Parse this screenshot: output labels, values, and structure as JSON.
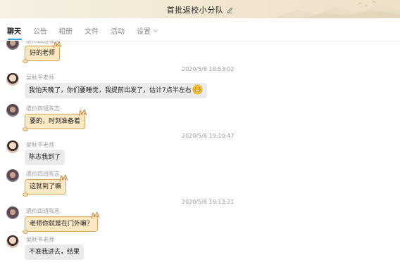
{
  "window": {
    "title": "首批返校小分队"
  },
  "tabs": [
    {
      "label": "聊天"
    },
    {
      "label": "公告"
    },
    {
      "label": "相册"
    },
    {
      "label": "文件"
    },
    {
      "label": "活动"
    },
    {
      "label": "设置"
    }
  ],
  "senders": {
    "agent": "遗价四班陈志",
    "teacher": "吴秋平老师"
  },
  "messages": [
    {
      "text": "好的老师"
    },
    {
      "time": "2020/5/8 18:53:02"
    },
    {
      "text": "我怕天晚了，你们要睡觉，我提前出发了，估计7点半左右"
    },
    {
      "text": "要的，时刻准备着"
    },
    {
      "time": "2020/5/8 19:10:47"
    },
    {
      "text": "陈志我到了"
    },
    {
      "text": "这就到了嘛"
    },
    {
      "time": "2020/5/8 19:13:21"
    },
    {
      "text": "老师你就是在门外嘛？"
    },
    {
      "text": "不准我进去，结果"
    }
  ],
  "colors": {
    "accent": "#2aa4e6",
    "cat_bubble": "#fbe9c4",
    "grey_bubble": "#ebebeb"
  }
}
